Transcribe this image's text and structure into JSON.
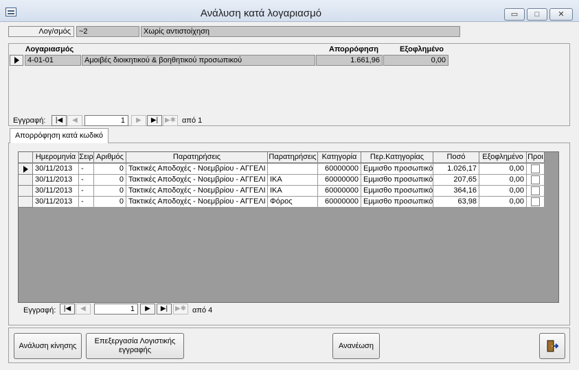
{
  "window": {
    "title": "Ανάλυση κατά λογαριασμό",
    "min_glyph": "▭",
    "max_glyph": "□",
    "close_glyph": "✕"
  },
  "header": {
    "label": "Λογ/σμός",
    "code": "~2",
    "description": "Χωρίς αντιστοίχηση"
  },
  "accounts": {
    "columns": {
      "account": "Λογαριασμός",
      "absorption": "Απορρόφηση",
      "paid": "Εξοφλημένο"
    },
    "rows": [
      {
        "code": "4-01-01",
        "name": "Αμοιβές διοικητικού & βοηθητικού προσωπικού",
        "absorption": "1.661,96",
        "paid": "0,00"
      }
    ],
    "nav": {
      "label": "Εγγραφή:",
      "current": "1",
      "of_label": "από",
      "total": "1"
    }
  },
  "tab": {
    "label": "Απορρόφηση κατά κωδικό"
  },
  "entries": {
    "columns": [
      "Ημερομηνία",
      "Σειρ",
      "Αριθμός",
      "Παρατηρήσεις",
      "Παρατηρήσεις",
      "Κατηγορία",
      "Περ.Κατηγορίας",
      "Ποσό",
      "Εξοφλημένο",
      "Προι"
    ],
    "rows": [
      {
        "date": "30/11/2013",
        "series": "-",
        "number": "0",
        "notes": "Τακτικές Αποδοχές - Νοεμβρίου - ΑΓΓΕΛΙ",
        "notes2": "",
        "category": "60000000",
        "category_desc": "Εμμισθο προσωπικό",
        "amount": "1.026,17",
        "paid": "0,00"
      },
      {
        "date": "30/11/2013",
        "series": "-",
        "number": "0",
        "notes": "Τακτικές Αποδοχές - Νοεμβρίου - ΑΓΓΕΛΙ",
        "notes2": "ΙΚΑ",
        "category": "60000000",
        "category_desc": "Εμμισθο προσωπικό",
        "amount": "207,65",
        "paid": "0,00"
      },
      {
        "date": "30/11/2013",
        "series": "-",
        "number": "0",
        "notes": "Τακτικές Αποδοχές - Νοεμβρίου - ΑΓΓΕΛΙ",
        "notes2": "ΙΚΑ",
        "category": "60000000",
        "category_desc": "Εμμισθο προσωπικό",
        "amount": "364,16",
        "paid": "0,00"
      },
      {
        "date": "30/11/2013",
        "series": "-",
        "number": "0",
        "notes": "Τακτικές Αποδοχές - Νοεμβρίου - ΑΓΓΕΛΙ",
        "notes2": "Φόρος",
        "category": "60000000",
        "category_desc": "Εμμισθο προσωπικό",
        "amount": "63,98",
        "paid": "0,00"
      }
    ],
    "nav": {
      "label": "Εγγραφή:",
      "current": "1",
      "of_label": "από",
      "total": "4"
    }
  },
  "nav_glyphs": {
    "first": "|◀",
    "prev": "◀",
    "next": "▶",
    "last": "▶|",
    "new": "▶✱"
  },
  "footer": {
    "movement_analysis": "Ανάλυση κίνησης",
    "edit_entry_line1": "Επεξεργασία Λογιστικής",
    "edit_entry_line2": "εγγραφής",
    "refresh": "Ανανέωση",
    "exit_icon": "exit-door-icon"
  }
}
